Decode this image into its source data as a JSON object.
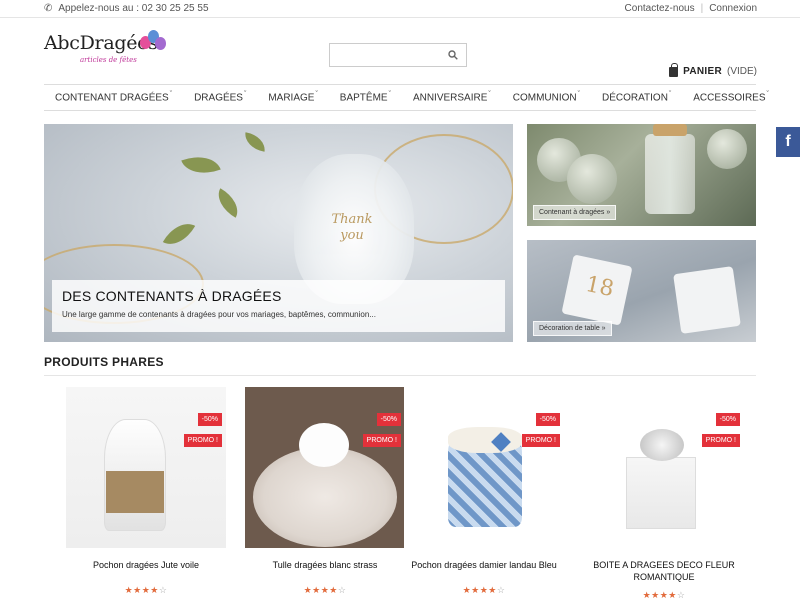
{
  "topbar": {
    "phone_text": "Appelez-nous au : 02 30 25 25 55",
    "contact": "Contactez-nous",
    "separator": "|",
    "login": "Connexion"
  },
  "logo": {
    "name": "AbcDragées",
    "tagline": "articles de fêtes"
  },
  "search": {
    "placeholder": ""
  },
  "cart": {
    "label": "PANIER",
    "state": "(VIDE)"
  },
  "nav": [
    {
      "label": "CONTENANT DRAGÉES",
      "has_dropdown": true
    },
    {
      "label": "DRAGÉES",
      "has_dropdown": true
    },
    {
      "label": "MARIAGE",
      "has_dropdown": true
    },
    {
      "label": "BAPTÊME",
      "has_dropdown": true
    },
    {
      "label": "ANNIVERSAIRE",
      "has_dropdown": true
    },
    {
      "label": "COMMUNION",
      "has_dropdown": true
    },
    {
      "label": "DÉCORATION",
      "has_dropdown": true
    },
    {
      "label": "ACCESSOIRES",
      "has_dropdown": true
    }
  ],
  "hero": {
    "title": "DES CONTENANTS À DRAGÉES",
    "text": "Une large gamme de contenants à dragées pour vos mariages, baptêmes, communion...",
    "image_text": "Thank you"
  },
  "side_banners": [
    {
      "label": "Contenant à dragées »"
    },
    {
      "label": "Décoration de table »",
      "image_text": "18"
    }
  ],
  "section_title": "PRODUITS PHARES",
  "products": [
    {
      "title": "Pochon dragées Jute voile",
      "discount": "-50%",
      "promo": "PROMO !",
      "rating": 4,
      "max_rating": 5
    },
    {
      "title": "Tulle dragées blanc strass",
      "discount": "-50%",
      "promo": "PROMO !",
      "rating": 4,
      "max_rating": 5
    },
    {
      "title": "Pochon dragées damier landau Bleu",
      "discount": "-50%",
      "promo": "PROMO !",
      "rating": 4,
      "max_rating": 5
    },
    {
      "title": "BOITE A DRAGEES DECO FLEUR ROMANTIQUE",
      "discount": "-50%",
      "promo": "PROMO !",
      "rating": 4,
      "max_rating": 5
    }
  ],
  "social": {
    "facebook": "f"
  },
  "icons": {
    "phone": "phone-icon",
    "search": "search-icon",
    "cart": "shopping-bag-icon",
    "dropdown": "chevron-down-icon",
    "star": "star-icon",
    "facebook": "facebook-icon"
  },
  "colors": {
    "promo_badge": "#e3313a",
    "stars": "#e26b3c",
    "facebook": "#3b5998",
    "tagline": "#c0399a"
  }
}
